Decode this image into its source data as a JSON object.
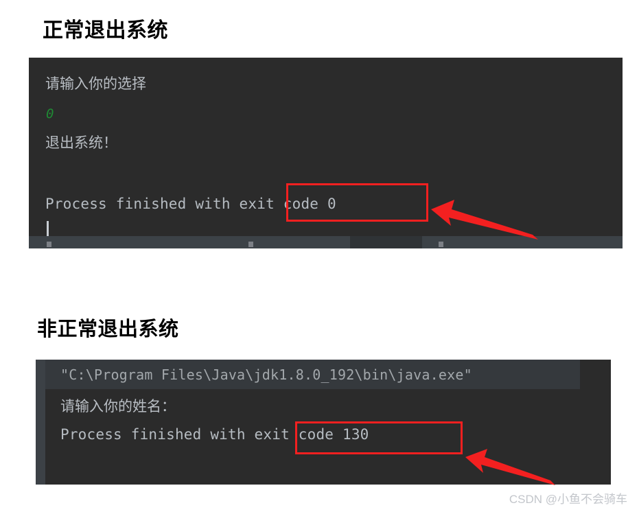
{
  "page": {
    "background_color": "#ffffff",
    "accent_color": "#f32020",
    "console_background": "#2b2b2b"
  },
  "sections": [
    {
      "heading": "正常退出系统",
      "console": {
        "clipped_top_sliver": "┄ ┄  ┄",
        "lines": [
          {
            "text": "请输入你的选择",
            "style": "cjk"
          },
          {
            "text": "0",
            "style": "user-input"
          },
          {
            "text": "退出系统！",
            "style": "cjk"
          },
          {
            "text": "Process finished with exit code 0",
            "style": "mono"
          }
        ],
        "annotation": {
          "box_label": "exit code 0",
          "box_color": "#f32020",
          "arrow": "arrow-pointing-up-left"
        }
      }
    },
    {
      "heading": "非正常退出系统",
      "console": {
        "lines": [
          {
            "text": "\"C:\\Program Files\\Java\\jdk1.8.0_192\\bin\\java.exe\"",
            "style": "mono-path"
          },
          {
            "text": "请输入你的姓名：",
            "style": "cjk"
          },
          {
            "text": "Process finished with exit code 130",
            "style": "mono"
          }
        ],
        "annotation": {
          "box_label": "exit code 130",
          "box_color": "#f32020",
          "arrow": "arrow-pointing-up-left"
        }
      }
    }
  ],
  "watermark": {
    "text": "CSDN @小鱼不会骑车"
  }
}
